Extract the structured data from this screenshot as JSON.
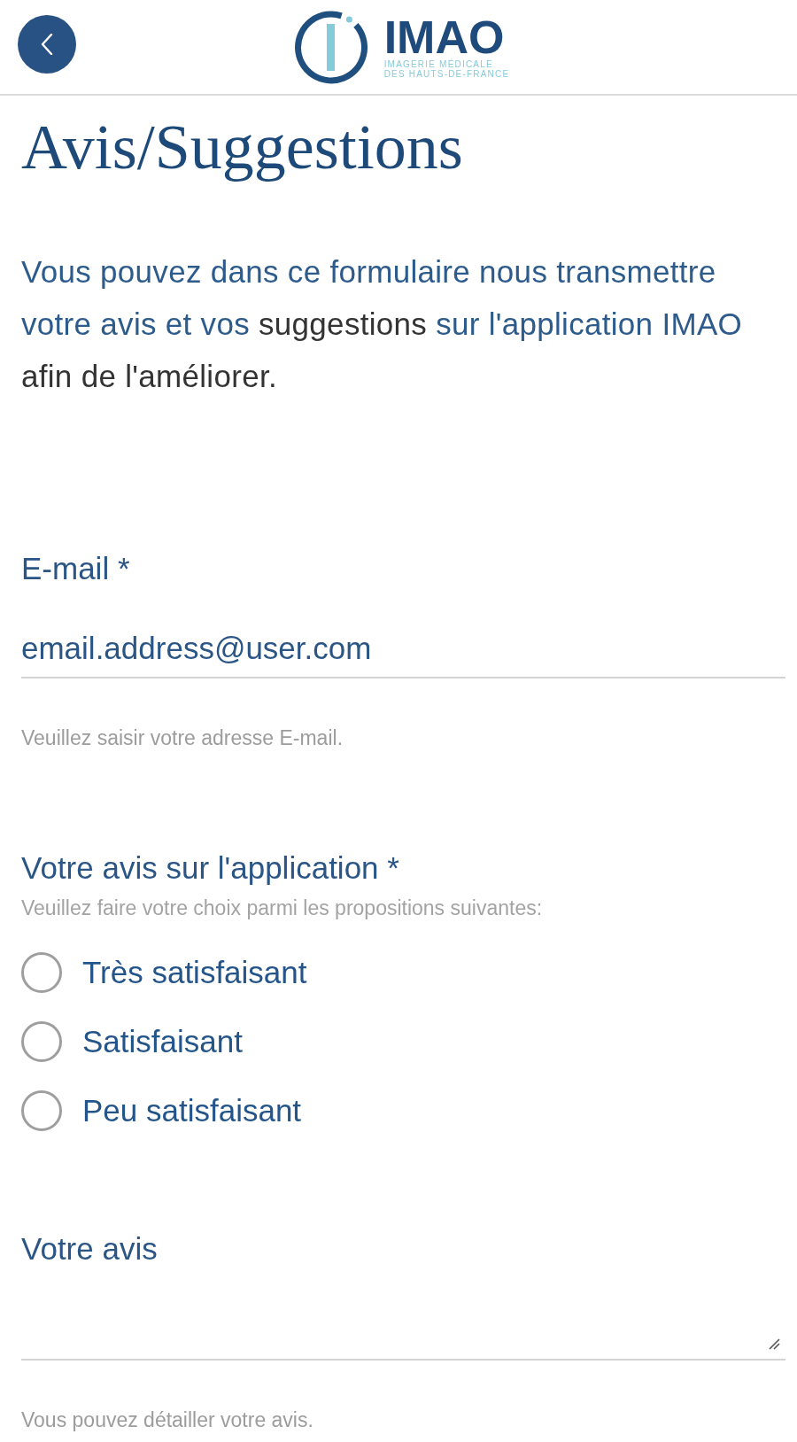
{
  "logo": {
    "wordmark": "IMAO",
    "tagline": [
      "IMAGERIE MÉDICALE",
      "DES HAUTS-DE-FRANCE"
    ]
  },
  "page": {
    "title": "Avis/Suggestions",
    "intro": [
      {
        "text": "Vous pouvez dans ce formulaire nous transmettre votre avis et vos ",
        "dark": false
      },
      {
        "text": "suggestions",
        "dark": true
      },
      {
        "text": " sur l'application IMAO ",
        "dark": false
      },
      {
        "text": "afin de l'améliorer.",
        "dark": true
      }
    ]
  },
  "form": {
    "fields": [
      {
        "kind": "text",
        "label": "E-mail *",
        "value": "email.address@user.com",
        "help": "Veuillez saisir votre adresse E-mail."
      },
      {
        "kind": "choice",
        "label": "Votre avis sur l'application *",
        "hint": "Veuillez faire votre choix parmi les propositions suivantes:",
        "options": [
          {
            "label": "Très satisfaisant",
            "selected": false
          },
          {
            "label": "Satisfaisant",
            "selected": false
          },
          {
            "label": "Peu satisfaisant",
            "selected": false
          }
        ]
      },
      {
        "kind": "textarea",
        "label": "Votre avis",
        "help": "Vous pouvez détailler votre avis."
      }
    ]
  }
}
